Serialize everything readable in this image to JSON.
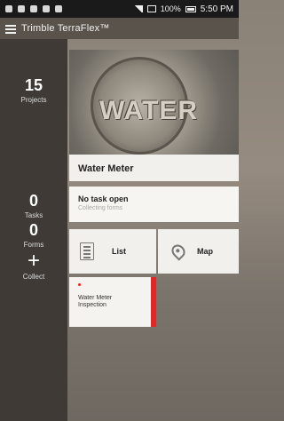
{
  "status_bar": {
    "time": "5:50 PM",
    "battery": "100%"
  },
  "app": {
    "title": "Trimble TerraFlex™"
  },
  "sidebar": {
    "projects": {
      "count": "15",
      "label": "Projects"
    },
    "tasks": {
      "count": "0",
      "label": "Tasks"
    },
    "forms": {
      "count": "0",
      "label": "Forms"
    },
    "collect": {
      "label": "Collect"
    }
  },
  "project": {
    "image_text": "WATER",
    "name": "Water Meter"
  },
  "task": {
    "title": "No task open",
    "subtitle": "Collecting forms"
  },
  "actions": {
    "list_label": "List",
    "map_label": "Map"
  },
  "forms": [
    {
      "name": "Water Meter Inspection",
      "accent": "#e32626"
    }
  ]
}
